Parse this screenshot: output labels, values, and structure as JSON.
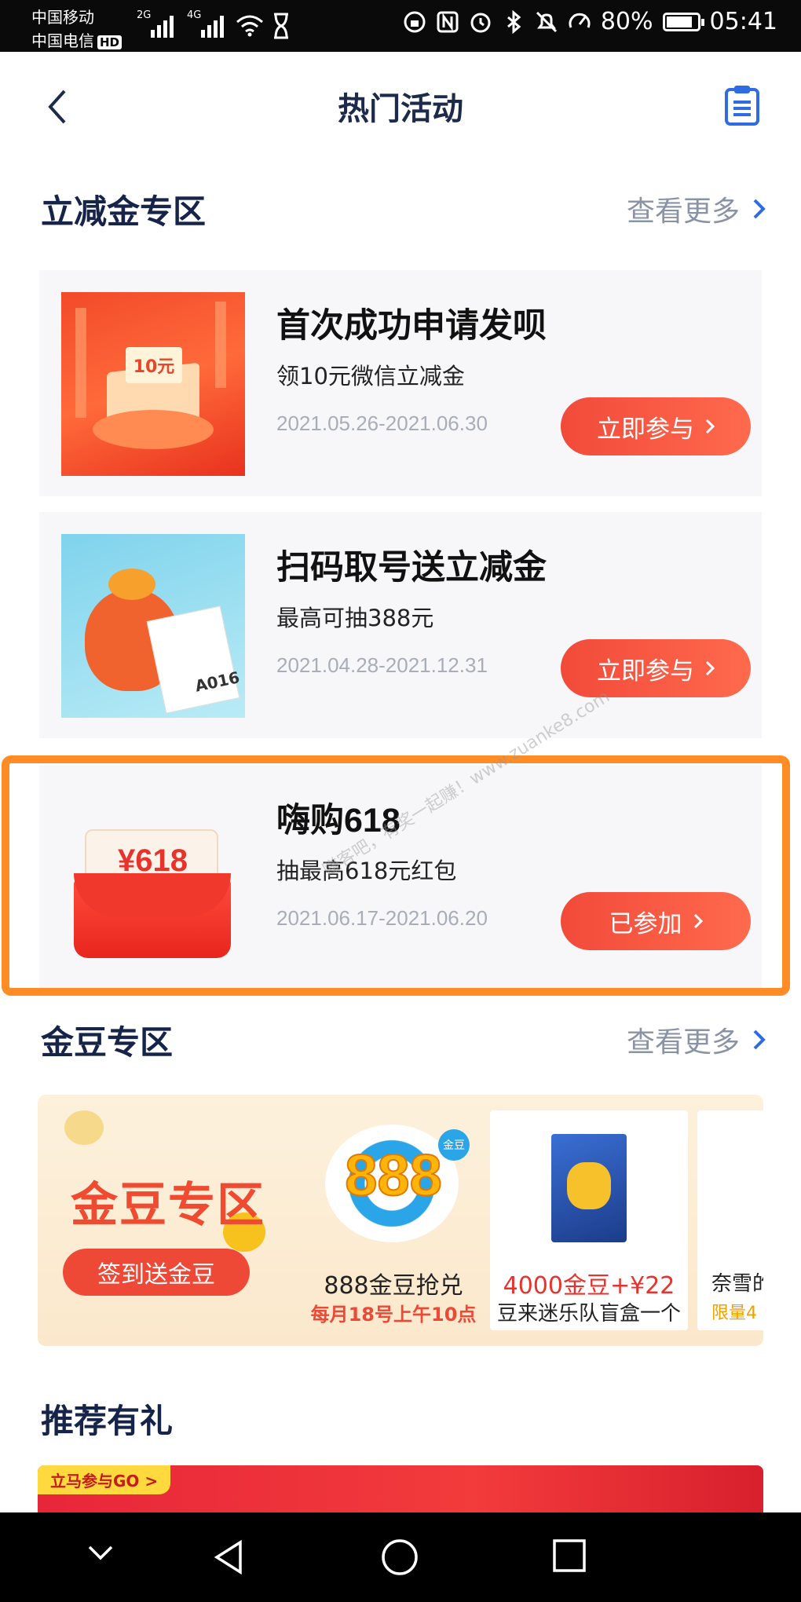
{
  "status_bar": {
    "carrier1": "中国移动",
    "carrier2": "中国电信",
    "hd": "HD",
    "net1": "2G",
    "net2": "4G",
    "battery": "80%",
    "battery_level": 0.8,
    "time": "05:41"
  },
  "header": {
    "title": "热门活动"
  },
  "section_discount": {
    "title": "立减金专区",
    "more": "查看更多"
  },
  "activities": [
    {
      "title": "首次成功申请发呗",
      "subtitle": "领10元微信立减金",
      "date": "2021.05.26-2021.06.30",
      "button": "立即参与",
      "thumb_text": "10元"
    },
    {
      "title": "扫码取号送立减金",
      "subtitle": "最高可抽388元",
      "date": "2021.04.28-2021.12.31",
      "button": "立即参与",
      "thumb_text": "A016"
    },
    {
      "title": "嗨购618",
      "subtitle": "抽最高618元红包",
      "date": "2021.06.17-2021.06.20",
      "button": "已参加",
      "thumb_text": "¥618"
    }
  ],
  "section_bean": {
    "title": "金豆专区",
    "more": "查看更多"
  },
  "bean_banner": {
    "title": "金豆专区",
    "signin": "签到送金豆",
    "products": [
      {
        "logo": "888",
        "badge": "金豆",
        "line1": "888金豆抢兑",
        "line2": "每月18号上午10点"
      },
      {
        "line1": "4000金豆+¥22",
        "line2": "豆来迷乐队盲盒一个"
      },
      {
        "line1": "奈雪的",
        "line2": "限量4"
      }
    ]
  },
  "section_recommend": {
    "title": "推荐有礼"
  },
  "recommend_banner": {
    "tag": "立马参与GO >"
  },
  "watermark": "赚客吧，有奖一起赚！www.zuanke8.com",
  "colors": {
    "accent": "#f24a3a",
    "highlight": "#ff8c24",
    "title": "#16244a"
  }
}
